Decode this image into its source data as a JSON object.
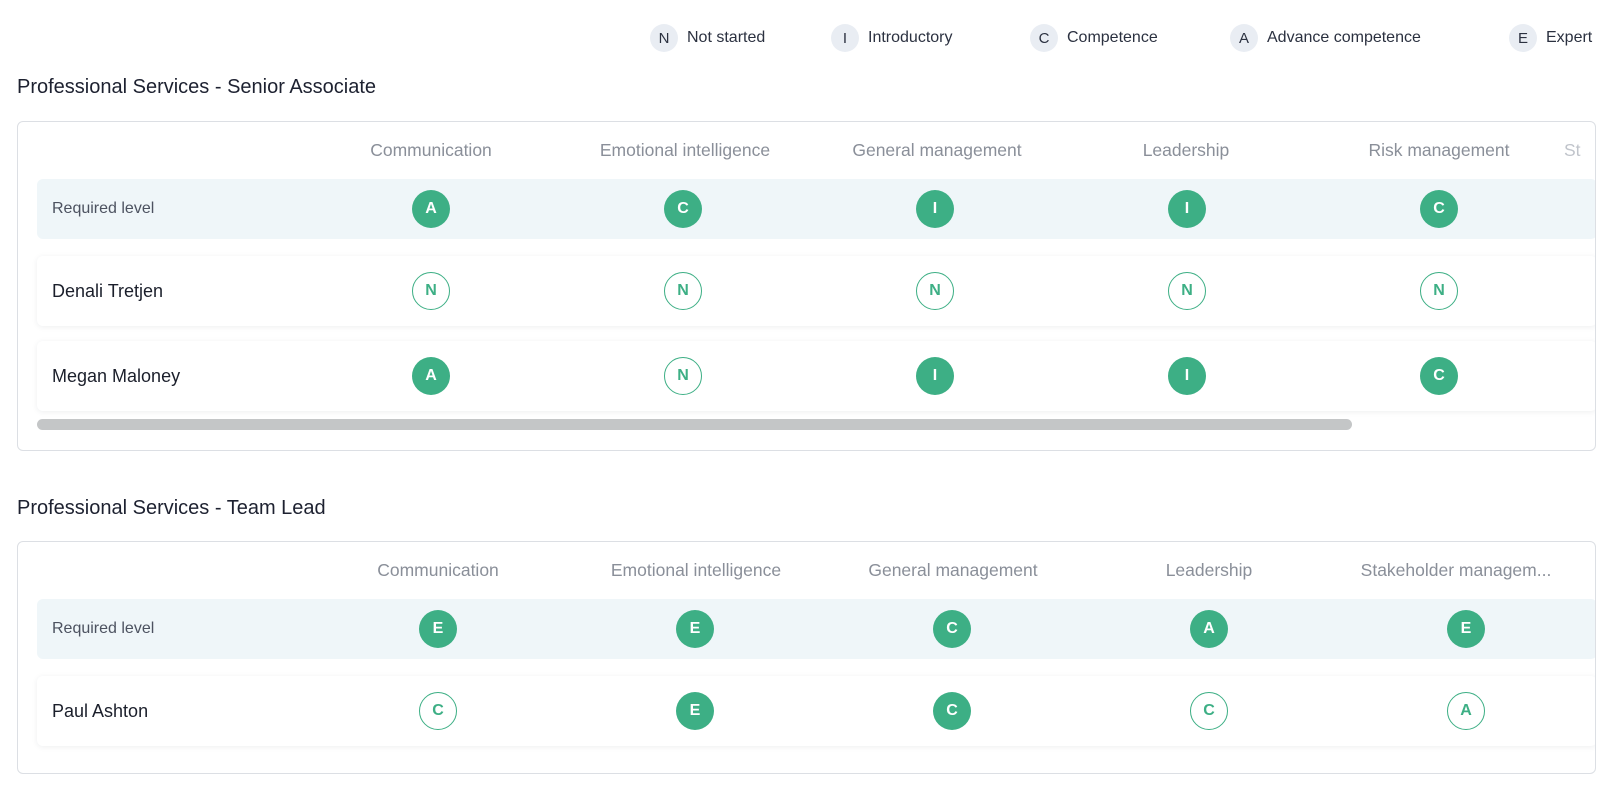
{
  "legend": [
    {
      "code": "N",
      "label": "Not started"
    },
    {
      "code": "I",
      "label": "Introductory"
    },
    {
      "code": "C",
      "label": "Competence"
    },
    {
      "code": "A",
      "label": "Advance competence"
    },
    {
      "code": "E",
      "label": "Expert"
    }
  ],
  "sections": [
    {
      "title": "Professional Services - Senior Associate",
      "columns": [
        "Communication",
        "Emotional intelligence",
        "General management",
        "Leadership",
        "Risk management",
        "St"
      ],
      "required": {
        "label": "Required level",
        "levels": [
          "A",
          "C",
          "I",
          "I",
          "C"
        ]
      },
      "people": [
        {
          "name": "Denali Tretjen",
          "levels": [
            "N",
            "N",
            "N",
            "N",
            "N"
          ],
          "filled": [
            false,
            false,
            false,
            false,
            false
          ]
        },
        {
          "name": "Megan Maloney",
          "levels": [
            "A",
            "N",
            "I",
            "I",
            "C"
          ],
          "filled": [
            true,
            false,
            true,
            true,
            true
          ]
        }
      ]
    },
    {
      "title": "Professional Services - Team Lead",
      "columns": [
        "Communication",
        "Emotional intelligence",
        "General management",
        "Leadership",
        "Stakeholder managem..."
      ],
      "required": {
        "label": "Required level",
        "levels": [
          "E",
          "E",
          "C",
          "A",
          "E"
        ]
      },
      "people": [
        {
          "name": "Paul Ashton",
          "levels": [
            "C",
            "E",
            "C",
            "C",
            "A"
          ],
          "filled": [
            false,
            true,
            true,
            false,
            false
          ]
        }
      ]
    }
  ],
  "colors": {
    "accent": "#3daf85",
    "required_row_bg": "#eff6f9",
    "legend_badge_bg": "#e9edf3"
  }
}
